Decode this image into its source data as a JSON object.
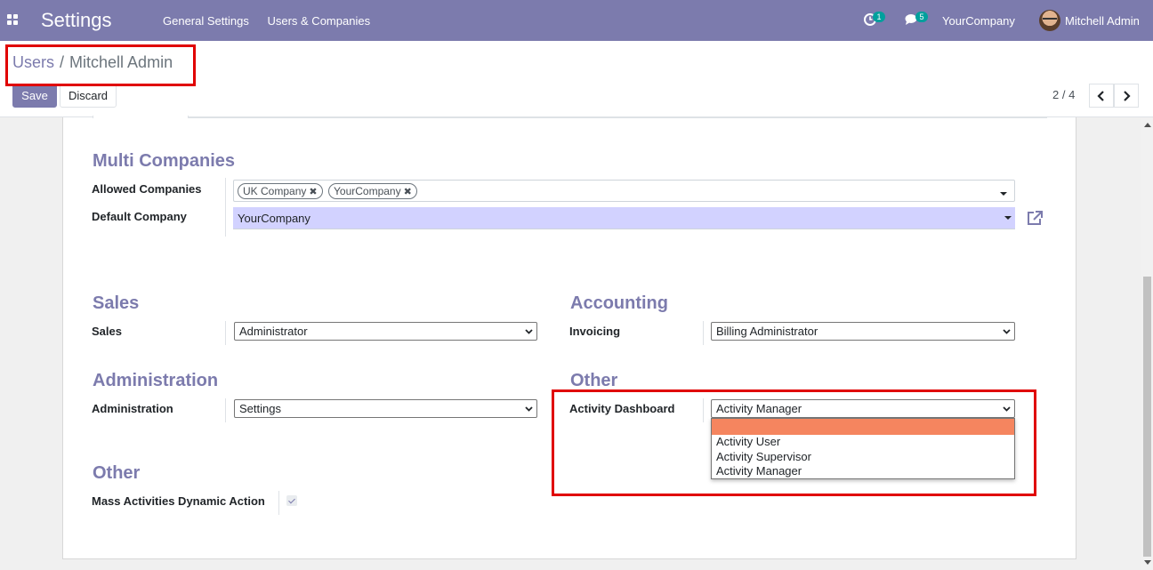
{
  "navbar": {
    "app_title": "Settings",
    "menu": [
      "General Settings",
      "Users & Companies"
    ],
    "activity_count": "1",
    "message_count": "5",
    "company": "YourCompany",
    "user": "Mitchell Admin"
  },
  "breadcrumb": {
    "parent": "Users",
    "separator": "/",
    "current": "Mitchell Admin"
  },
  "toolbar": {
    "save_label": "Save",
    "discard_label": "Discard"
  },
  "pager": {
    "value": "2 / 4",
    "prev_icon": "chevron-left-icon",
    "next_icon": "chevron-right-icon"
  },
  "form": {
    "multi_companies": {
      "title": "Multi Companies",
      "allowed_label": "Allowed Companies",
      "allowed_tags": [
        "UK Company",
        "YourCompany"
      ],
      "default_label": "Default Company",
      "default_value": "YourCompany"
    },
    "sales": {
      "title": "Sales",
      "label": "Sales",
      "value": "Administrator"
    },
    "accounting": {
      "title": "Accounting",
      "label": "Invoicing",
      "value": "Billing Administrator"
    },
    "administration": {
      "title": "Administration",
      "label": "Administration",
      "value": "Settings"
    },
    "other_right": {
      "title": "Other",
      "label": "Activity Dashboard",
      "value": "Activity Manager",
      "options": [
        "",
        "Activity User",
        "Activity Supervisor",
        "Activity Manager"
      ]
    },
    "other_left": {
      "title": "Other",
      "label": "Mass Activities Dynamic Action",
      "checked": true
    }
  },
  "colors": {
    "brand": "#7c7bad",
    "highlight": "#e00000",
    "option_hover": "#f5855f",
    "many2one_bg": "#d2d2ff"
  }
}
